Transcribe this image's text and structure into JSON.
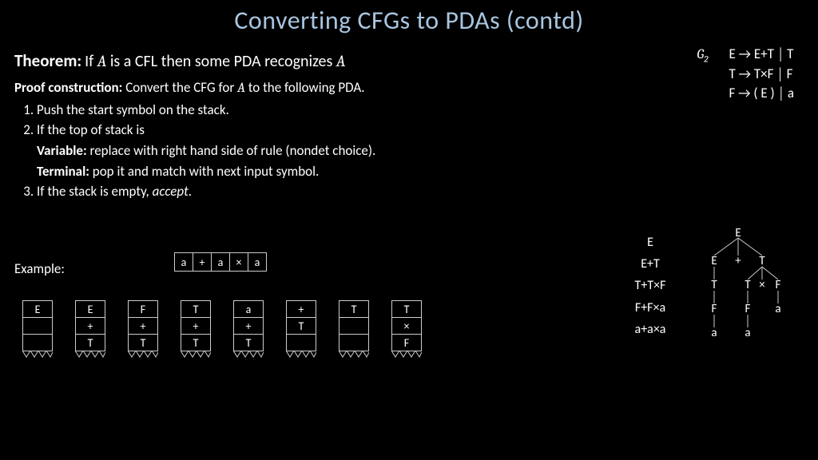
{
  "title": "Converting CFGs to PDAs  (contd)",
  "theorem": {
    "label": "Theorem:",
    "text_a": "If ",
    "A1": "A",
    "text_b": " is a CFL then some PDA recognizes ",
    "A2": "A"
  },
  "proof": {
    "label": "Proof construction:",
    "text_a": "  Convert the CFG for ",
    "A": "A",
    "text_b": " to the following PDA."
  },
  "steps": {
    "s1": "Push the start symbol on the stack.",
    "s2": "If the top of stack is",
    "s2a_label": "Variable:",
    "s2a_text": "  replace with right hand side of rule (nondet choice).",
    "s2b_label": "Terminal:",
    "s2b_text": "  pop it and match with next input symbol.",
    "s3_a": "If the stack is empty, ",
    "s3_b": "accept",
    "s3_c": "."
  },
  "example_label": "Example:",
  "tape": [
    "a",
    "+",
    "a",
    "×",
    "a"
  ],
  "stacks": [
    [
      "E",
      "",
      ""
    ],
    [
      "E",
      "+",
      "T"
    ],
    [
      "F",
      "+",
      "T"
    ],
    [
      "T",
      "+",
      "T"
    ],
    [
      "a",
      "+",
      "T"
    ],
    [
      "+",
      "T",
      ""
    ],
    [
      "T",
      "",
      ""
    ],
    [
      "T",
      "×",
      "F"
    ]
  ],
  "grammar": {
    "name": "G",
    "sub": "2",
    "r1": "E → E+T │ T",
    "r2": "T → T×F │ F",
    "r3": "F → ( E ) │ a"
  },
  "deriv": {
    "l1": "E",
    "l2": "E+T",
    "l3": "T+T×F",
    "l4": "F+F×a",
    "l5": "a+a×a"
  },
  "tree_nodes": {
    "n1": "E",
    "n2": "E",
    "n3": "+",
    "n4": "T",
    "n5": "T",
    "n6": "T",
    "n7": "×",
    "n8": "F",
    "n9": "F",
    "n10": "F",
    "n11": "a",
    "n12": "a",
    "n13": "a"
  }
}
